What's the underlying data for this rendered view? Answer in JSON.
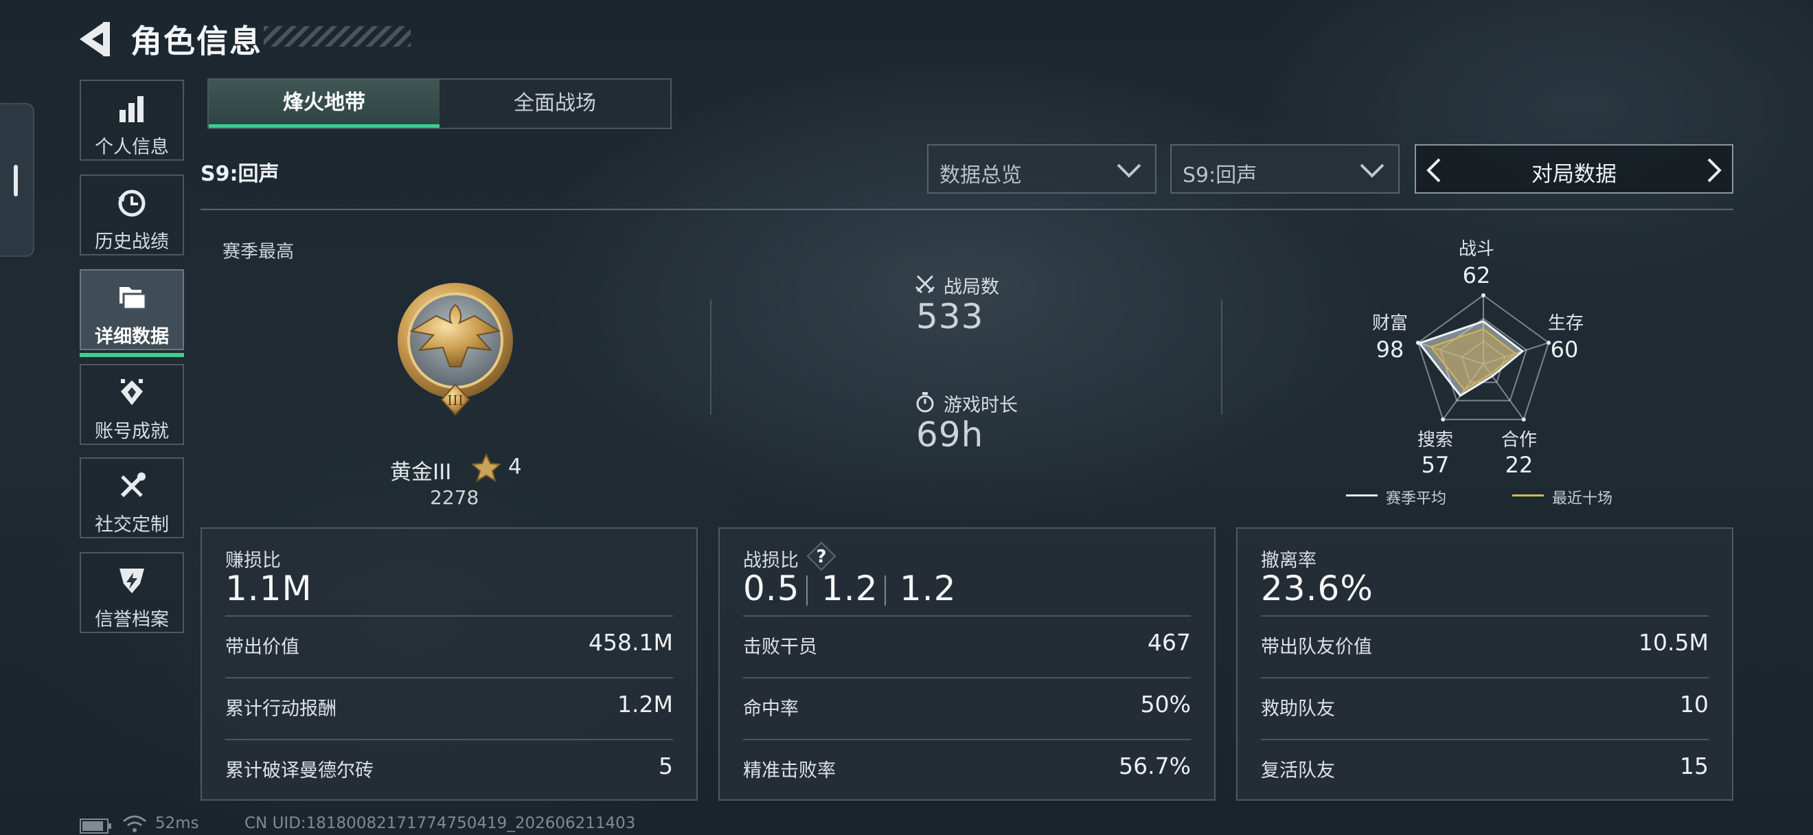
{
  "header": {
    "title": "角色信息"
  },
  "sidebar": {
    "items": [
      {
        "label": "个人信息",
        "icon": "bar-chart-icon"
      },
      {
        "label": "历史战绩",
        "icon": "history-clock-icon"
      },
      {
        "label": "详细数据",
        "icon": "folders-icon",
        "active": true
      },
      {
        "label": "账号成就",
        "icon": "achievement-icon"
      },
      {
        "label": "社交定制",
        "icon": "tools-icon"
      },
      {
        "label": "信誉档案",
        "icon": "reputation-icon"
      }
    ]
  },
  "tabs": [
    {
      "label": "烽火地带",
      "active": true
    },
    {
      "label": "全面战场",
      "active": false
    }
  ],
  "season_label": "S9:回声",
  "filters": {
    "data_type": "数据总览",
    "season": "S9:回声",
    "mode": "对局数据"
  },
  "season_best": {
    "label": "赛季最高",
    "rank": "黄金III",
    "stars": "4",
    "score": "2278"
  },
  "summary": {
    "matches_label": "战局数",
    "matches_value": "533",
    "playtime_label": "游戏时长",
    "playtime_value": "69h"
  },
  "radar": {
    "axes": [
      {
        "label": "战斗",
        "value": "62"
      },
      {
        "label": "生存",
        "value": "60"
      },
      {
        "label": "合作",
        "value": "22"
      },
      {
        "label": "搜索",
        "value": "57"
      },
      {
        "label": "财富",
        "value": "98"
      }
    ],
    "legend": [
      {
        "label": "赛季平均",
        "color": "#e6e9ec"
      },
      {
        "label": "最近十场",
        "color": "#d8b84a"
      }
    ]
  },
  "panels": {
    "profit": {
      "title": "赚损比",
      "main": "1.1M",
      "rows": [
        {
          "label": "带出价值",
          "value": "458.1M"
        },
        {
          "label": "累计行动报酬",
          "value": "1.2M"
        },
        {
          "label": "累计破译曼德尔砖",
          "value": "5"
        }
      ]
    },
    "kd": {
      "title": "战损比",
      "help": "?",
      "values": [
        "0.5",
        "1.2",
        "1.2"
      ],
      "rows": [
        {
          "label": "击败干员",
          "value": "467"
        },
        {
          "label": "命中率",
          "value": "50%"
        },
        {
          "label": "精准击败率",
          "value": "56.7%"
        }
      ]
    },
    "extract": {
      "title": "撤离率",
      "main": "23.6%",
      "rows": [
        {
          "label": "带出队友价值",
          "value": "10.5M"
        },
        {
          "label": "救助队友",
          "value": "10"
        },
        {
          "label": "复活队友",
          "value": "15"
        }
      ]
    }
  },
  "footer": {
    "ping": "52ms",
    "uid": "CN UID:18180082171774750419_202606211403"
  }
}
